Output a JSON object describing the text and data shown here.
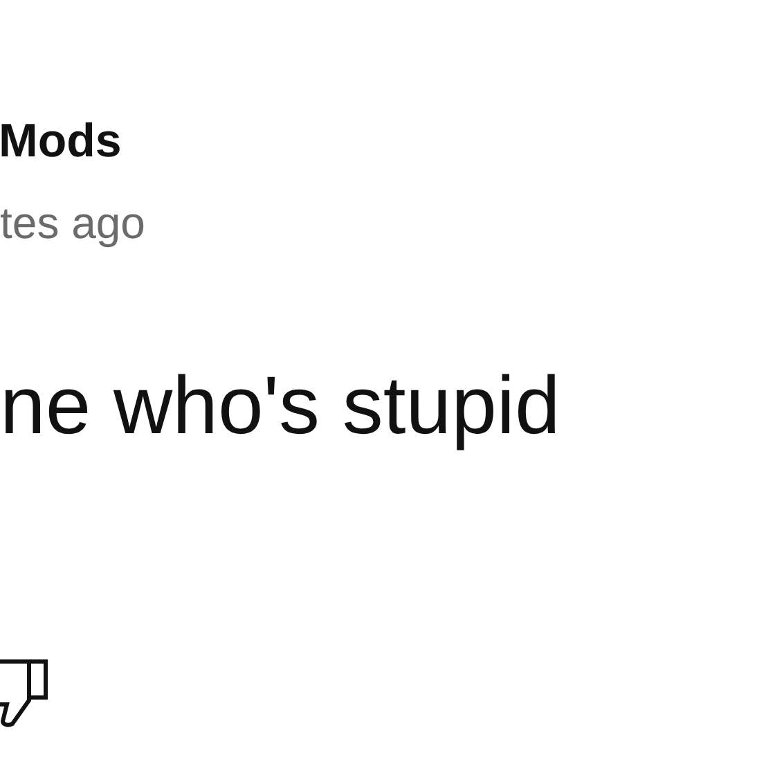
{
  "post": {
    "author": "Mods",
    "time": "tes ago",
    "body": "ne who's stupid"
  }
}
